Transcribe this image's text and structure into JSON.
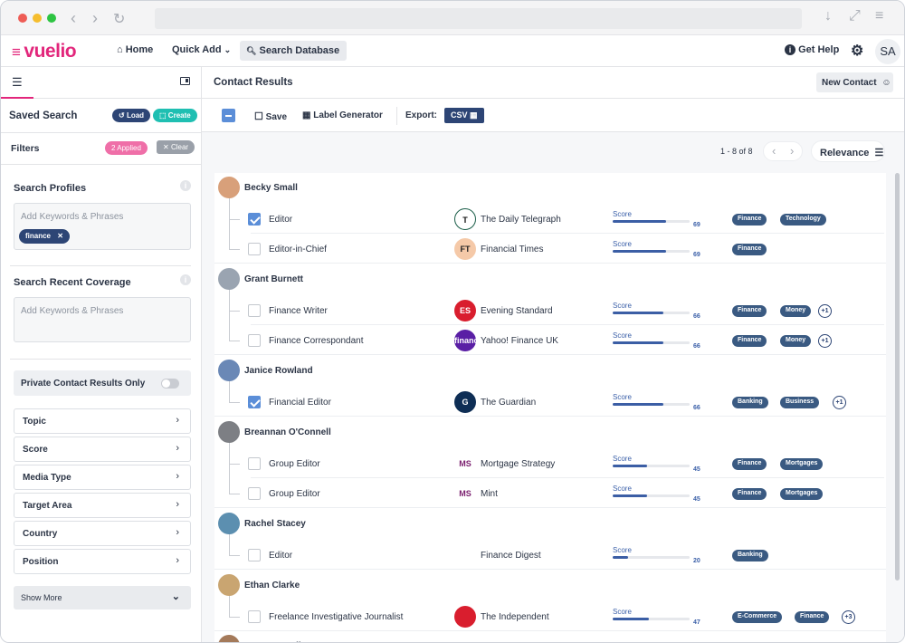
{
  "browser": {
    "colors": {
      "close": "#ee5c55",
      "minimize": "#f5bd2e",
      "maximize": "#2dc442"
    }
  },
  "nav": {
    "logo": "vuelio",
    "home": "Home",
    "quick_add": "Quick Add",
    "search_database": "Search Database",
    "get_help": "Get Help",
    "user_initials": "SA"
  },
  "sidebar": {
    "saved_search": "Saved Search",
    "load": "Load",
    "create": "Create",
    "filters": "Filters",
    "applied": "2 Applied",
    "clear": "Clear",
    "search_profiles": "Search Profiles",
    "keywords_placeholder": "Add Keywords & Phrases",
    "keyword_chip": "finance",
    "search_recent_coverage": "Search Recent Coverage",
    "coverage_placeholder": "Add Keywords & Phrases",
    "private_only": "Private Contact Results Only",
    "filter_items": [
      "Topic",
      "Score",
      "Media Type",
      "Target Area",
      "Country",
      "Position"
    ],
    "show_more": "Show More"
  },
  "main": {
    "title": "Contact Results",
    "new_contact": "New Contact",
    "toolbar": {
      "save": "Save",
      "label_generator": "Label Generator",
      "export": "Export:",
      "csv": "CSV"
    },
    "pagination": "1 - 8 of 8",
    "sort": "Relevance",
    "score_label": "Score",
    "contacts": [
      {
        "name": "Becky Small",
        "roles": [
          {
            "role": "Editor",
            "checked": true,
            "outlet": "The Daily Telegraph",
            "score": 69,
            "tags": [
              "Finance",
              "Technology"
            ],
            "more": ""
          },
          {
            "role": "Editor-in-Chief",
            "checked": false,
            "outlet": "Financial Times",
            "score": 69,
            "tags": [
              "Finance"
            ],
            "more": ""
          }
        ]
      },
      {
        "name": "Grant Burnett",
        "roles": [
          {
            "role": "Finance Writer",
            "checked": false,
            "outlet": "Evening Standard",
            "score": 66,
            "tags": [
              "Finance",
              "Money"
            ],
            "more": "+1"
          },
          {
            "role": "Finance Correspondant",
            "checked": false,
            "outlet": "Yahoo! Finance UK",
            "score": 66,
            "tags": [
              "Finance",
              "Money"
            ],
            "more": "+1"
          }
        ]
      },
      {
        "name": "Janice Rowland",
        "roles": [
          {
            "role": "Financial Editor",
            "checked": true,
            "outlet": "The Guardian",
            "score": 66,
            "tags": [
              "Banking",
              "Business"
            ],
            "more": "+1"
          }
        ]
      },
      {
        "name": "Breannan O'Connell",
        "roles": [
          {
            "role": "Group Editor",
            "checked": false,
            "outlet": "Mortgage Strategy",
            "score": 45,
            "tags": [
              "Finance",
              "Mortgages"
            ],
            "more": ""
          },
          {
            "role": "Group Editor",
            "checked": false,
            "outlet": "Mint",
            "score": 45,
            "tags": [
              "Finance",
              "Mortgages"
            ],
            "more": ""
          }
        ]
      },
      {
        "name": "Rachel Stacey",
        "roles": [
          {
            "role": "Editor",
            "checked": false,
            "outlet": "Finance Digest",
            "score": 20,
            "tags": [
              "Banking"
            ],
            "more": ""
          }
        ]
      },
      {
        "name": "Ethan Clarke",
        "roles": [
          {
            "role": "Freelance Investigative Journalist",
            "checked": false,
            "outlet": "The Independent",
            "score": 47,
            "tags": [
              "E-Commerce",
              "Finance"
            ],
            "more": "+3"
          }
        ]
      },
      {
        "name": "LaToya Harding",
        "roles": []
      }
    ],
    "outlet_logos": [
      "T",
      "FT",
      "ES",
      "finance",
      "G",
      "MS",
      "MS",
      "",
      ""
    ]
  }
}
